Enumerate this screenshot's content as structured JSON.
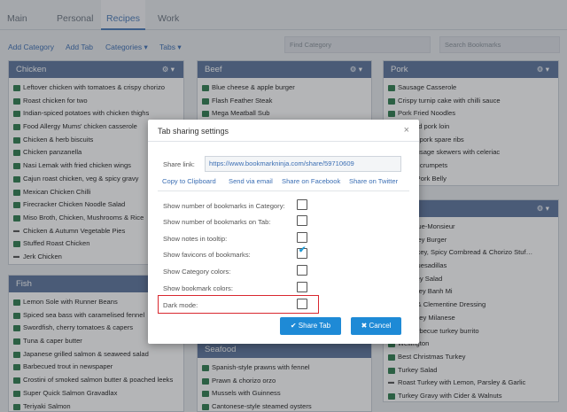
{
  "tabs": [
    "Main",
    "Personal",
    "Recipes",
    "Work"
  ],
  "toolbar": {
    "add_category": "Add Category",
    "add_tab": "Add Tab",
    "categories": "Categories",
    "tabs_menu": "Tabs",
    "find_category_placeholder": "Find Category",
    "search_bookmarks_placeholder": "Search Bookmarks"
  },
  "columns": {
    "chicken": {
      "title": "Chicken",
      "items": [
        {
          "label": "Leftover chicken with tomatoes & crispy chorizo",
          "icon": "bookmark"
        },
        {
          "label": "Roast chicken for two",
          "icon": "bookmark"
        },
        {
          "label": "Indian-spiced potatoes with chicken thighs",
          "icon": "bookmark"
        },
        {
          "label": "Food Allergy Mums' chicken casserole",
          "icon": "bookmark"
        },
        {
          "label": "Chicken & herb biscuits",
          "icon": "bookmark"
        },
        {
          "label": "Chicken panzanella",
          "icon": "bookmark"
        },
        {
          "label": "Nasi Lemak with fried chicken wings",
          "icon": "bookmark"
        },
        {
          "label": "Cajun roast chicken, veg & spicy gravy",
          "icon": "bookmark"
        },
        {
          "label": "Mexican Chicken Chilli",
          "icon": "bookmark"
        },
        {
          "label": "Firecracker Chicken Noodle Salad",
          "icon": "bookmark"
        },
        {
          "label": "Miso Broth, Chicken, Mushrooms & Rice",
          "icon": "bookmark"
        },
        {
          "label": "Chicken & Autumn Vegetable Pies",
          "icon": "favicon"
        },
        {
          "label": "Stuffed Roast Chicken",
          "icon": "bookmark"
        },
        {
          "label": "Jerk Chicken",
          "icon": "favicon"
        }
      ]
    },
    "fish": {
      "title": "Fish",
      "items": [
        {
          "label": "Lemon Sole with Runner Beans",
          "icon": "bookmark"
        },
        {
          "label": "Spiced sea bass with caramelised fennel",
          "icon": "bookmark"
        },
        {
          "label": "Swordfish, cherry tomatoes & capers",
          "icon": "bookmark"
        },
        {
          "label": "Tuna & caper butter",
          "icon": "bookmark"
        },
        {
          "label": "Japanese grilled salmon & seaweed salad",
          "icon": "bookmark"
        },
        {
          "label": "Barbecued trout in newspaper",
          "icon": "bookmark"
        },
        {
          "label": "Crostini of smoked salmon butter & poached leeks",
          "icon": "bookmark"
        },
        {
          "label": "Super Quick Salmon Gravadlax",
          "icon": "bookmark"
        },
        {
          "label": "Teriyaki Salmon",
          "icon": "bookmark"
        }
      ]
    },
    "beef": {
      "title": "Beef",
      "items": [
        {
          "label": "Blue cheese & apple burger",
          "icon": "bookmark"
        },
        {
          "label": "Flash Feather Steak",
          "icon": "bookmark"
        },
        {
          "label": "Mega Meatball Sub",
          "icon": "bookmark"
        }
      ]
    },
    "seafood": {
      "title": "Seafood",
      "items": [
        {
          "label": "Spanish-style prawns with fennel",
          "icon": "bookmark"
        },
        {
          "label": "Prawn & chorizo orzo",
          "icon": "bookmark"
        },
        {
          "label": "Mussels with Guinness",
          "icon": "bookmark"
        },
        {
          "label": "Cantonese-style steamed oysters",
          "icon": "bookmark"
        }
      ]
    },
    "pork": {
      "title": "Pork",
      "items": [
        {
          "label": "Sausage Casserole",
          "icon": "bookmark"
        },
        {
          "label": "Crispy turnip cake with chilli sauce",
          "icon": "bookmark"
        },
        {
          "label": "Pork Fried Noodles",
          "icon": "bookmark"
        },
        {
          "label": "rbecued pork loin",
          "icon": "bookmark"
        },
        {
          "label": "glazed pork spare ribs",
          "icon": "bookmark"
        },
        {
          "label": "ork sausage skewers with celeriac",
          "icon": "bookmark"
        },
        {
          "label": "udding crumpets",
          "icon": "bookmark"
        },
        {
          "label": "asted Pork Belly",
          "icon": "bookmark"
        }
      ]
    },
    "turkey": {
      "items": [
        {
          "label": "y Croque-Monsieur",
          "icon": "bookmark"
        },
        {
          "label": "C Turkey Burger",
          "icon": "bookmark"
        },
        {
          "label": "an Turkey, Spicy Cornbread & Chorizo Stuf…",
          "icon": "bookmark"
        },
        {
          "label": "Day Quesadillas",
          "icon": "bookmark"
        },
        {
          "label": "y Turkey Salad",
          "icon": "bookmark"
        },
        {
          "label": "er Turkey Banh Mi",
          "icon": "bookmark"
        },
        {
          "label": "Salad & Clementine Dressing",
          "icon": "bookmark"
        },
        {
          "label": "o's turkey Milanese",
          "icon": "bookmark"
        },
        {
          "label": "e & barbecue turkey burrito",
          "icon": "bookmark"
        },
        {
          "label": "Wellington",
          "icon": "bookmark"
        },
        {
          "label": "Best Christmas Turkey",
          "icon": "bookmark"
        },
        {
          "label": "Turkey Salad",
          "icon": "bookmark"
        },
        {
          "label": "Roast Turkey with Lemon, Parsley & Garlic",
          "icon": "favicon"
        },
        {
          "label": "Turkey Gravy with Cider & Walnuts",
          "icon": "bookmark"
        }
      ]
    }
  },
  "modal": {
    "title": "Tab sharing settings",
    "close": "×",
    "share_link_label": "Share link:",
    "share_link_value": "https://www.bookmarkninja.com/share/59710609",
    "links": [
      "Copy to Clipboard",
      "Send via email",
      "Share on Facebook",
      "Share on Twitter"
    ],
    "options": [
      {
        "label": "Show number of bookmarks in Category:",
        "checked": false
      },
      {
        "label": "Show number of bookmarks on Tab:",
        "checked": false
      },
      {
        "label": "Show notes in tooltip:",
        "checked": false
      },
      {
        "label": "Show favicons of bookmarks:",
        "checked": true
      },
      {
        "label": "Show Category colors:",
        "checked": false
      },
      {
        "label": "Show bookmark colors:",
        "checked": false
      },
      {
        "label": "Dark mode:",
        "checked": false
      }
    ],
    "share_button": "Share Tab",
    "cancel_button": "Cancel"
  },
  "colors": {
    "accent": "#1e8ad6",
    "column_header": "#5d769d",
    "highlight": "#d9282f",
    "link": "#3c6fb4"
  }
}
